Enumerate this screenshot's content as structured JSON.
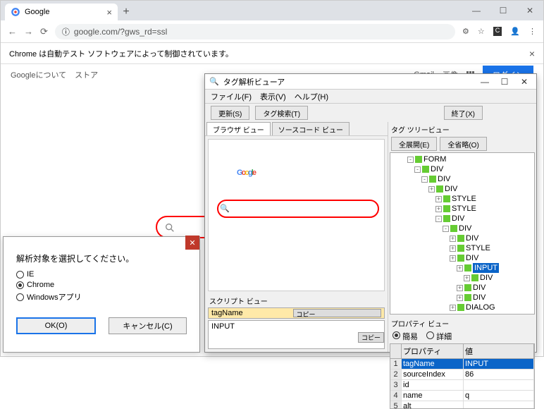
{
  "chrome": {
    "tab_title": "Google",
    "url_display": "google.com/?gws_rd=ssl",
    "notice": "Chrome は自動テスト ソフトウェアによって制御されています。"
  },
  "google": {
    "about": "Googleについて",
    "store": "ストア",
    "gmail": "Gmail",
    "images": "画像",
    "login": "ログイン"
  },
  "dialog": {
    "title": "解析対象を選択してください。",
    "opt_ie": "IE",
    "opt_chrome": "Chrome",
    "opt_winapp": "Windowsアプリ",
    "ok": "OK(O)",
    "cancel": "キャンセル(C)"
  },
  "viewer": {
    "title": "タグ解析ビューア",
    "menu_file": "ファイル(F)",
    "menu_view": "表示(V)",
    "menu_help": "ヘルプ(H)",
    "btn_update": "更新(S)",
    "btn_tagsearch": "タグ検索(T)",
    "btn_exit": "終了(X)",
    "tab_browser": "ブラウザ ビュー",
    "tab_source": "ソースコード ビュー",
    "script_label": "スクリプト ビュー",
    "script_input": "tagName",
    "script_output": "INPUT",
    "copy": "コピー",
    "tree_label": "タグ ツリービュー",
    "btn_expand": "全展開(E)",
    "btn_collapse": "全省略(O)",
    "tree": [
      "FORM",
      "DIV",
      "DIV",
      "DIV",
      "STYLE",
      "STYLE",
      "DIV",
      "DIV",
      "DIV",
      "STYLE",
      "DIV",
      "INPUT",
      "DIV",
      "DIV",
      "DIV",
      "DIALOG"
    ],
    "prop_label": "プロパティ ビュー",
    "prop_simple": "簡易",
    "prop_detail": "詳細",
    "prop_header_name": "プロパティ",
    "prop_header_val": "値",
    "props": [
      {
        "n": "tagName",
        "v": "INPUT"
      },
      {
        "n": "sourceIndex",
        "v": "86"
      },
      {
        "n": "id",
        "v": ""
      },
      {
        "n": "name",
        "v": "q"
      },
      {
        "n": "alt",
        "v": ""
      }
    ]
  }
}
